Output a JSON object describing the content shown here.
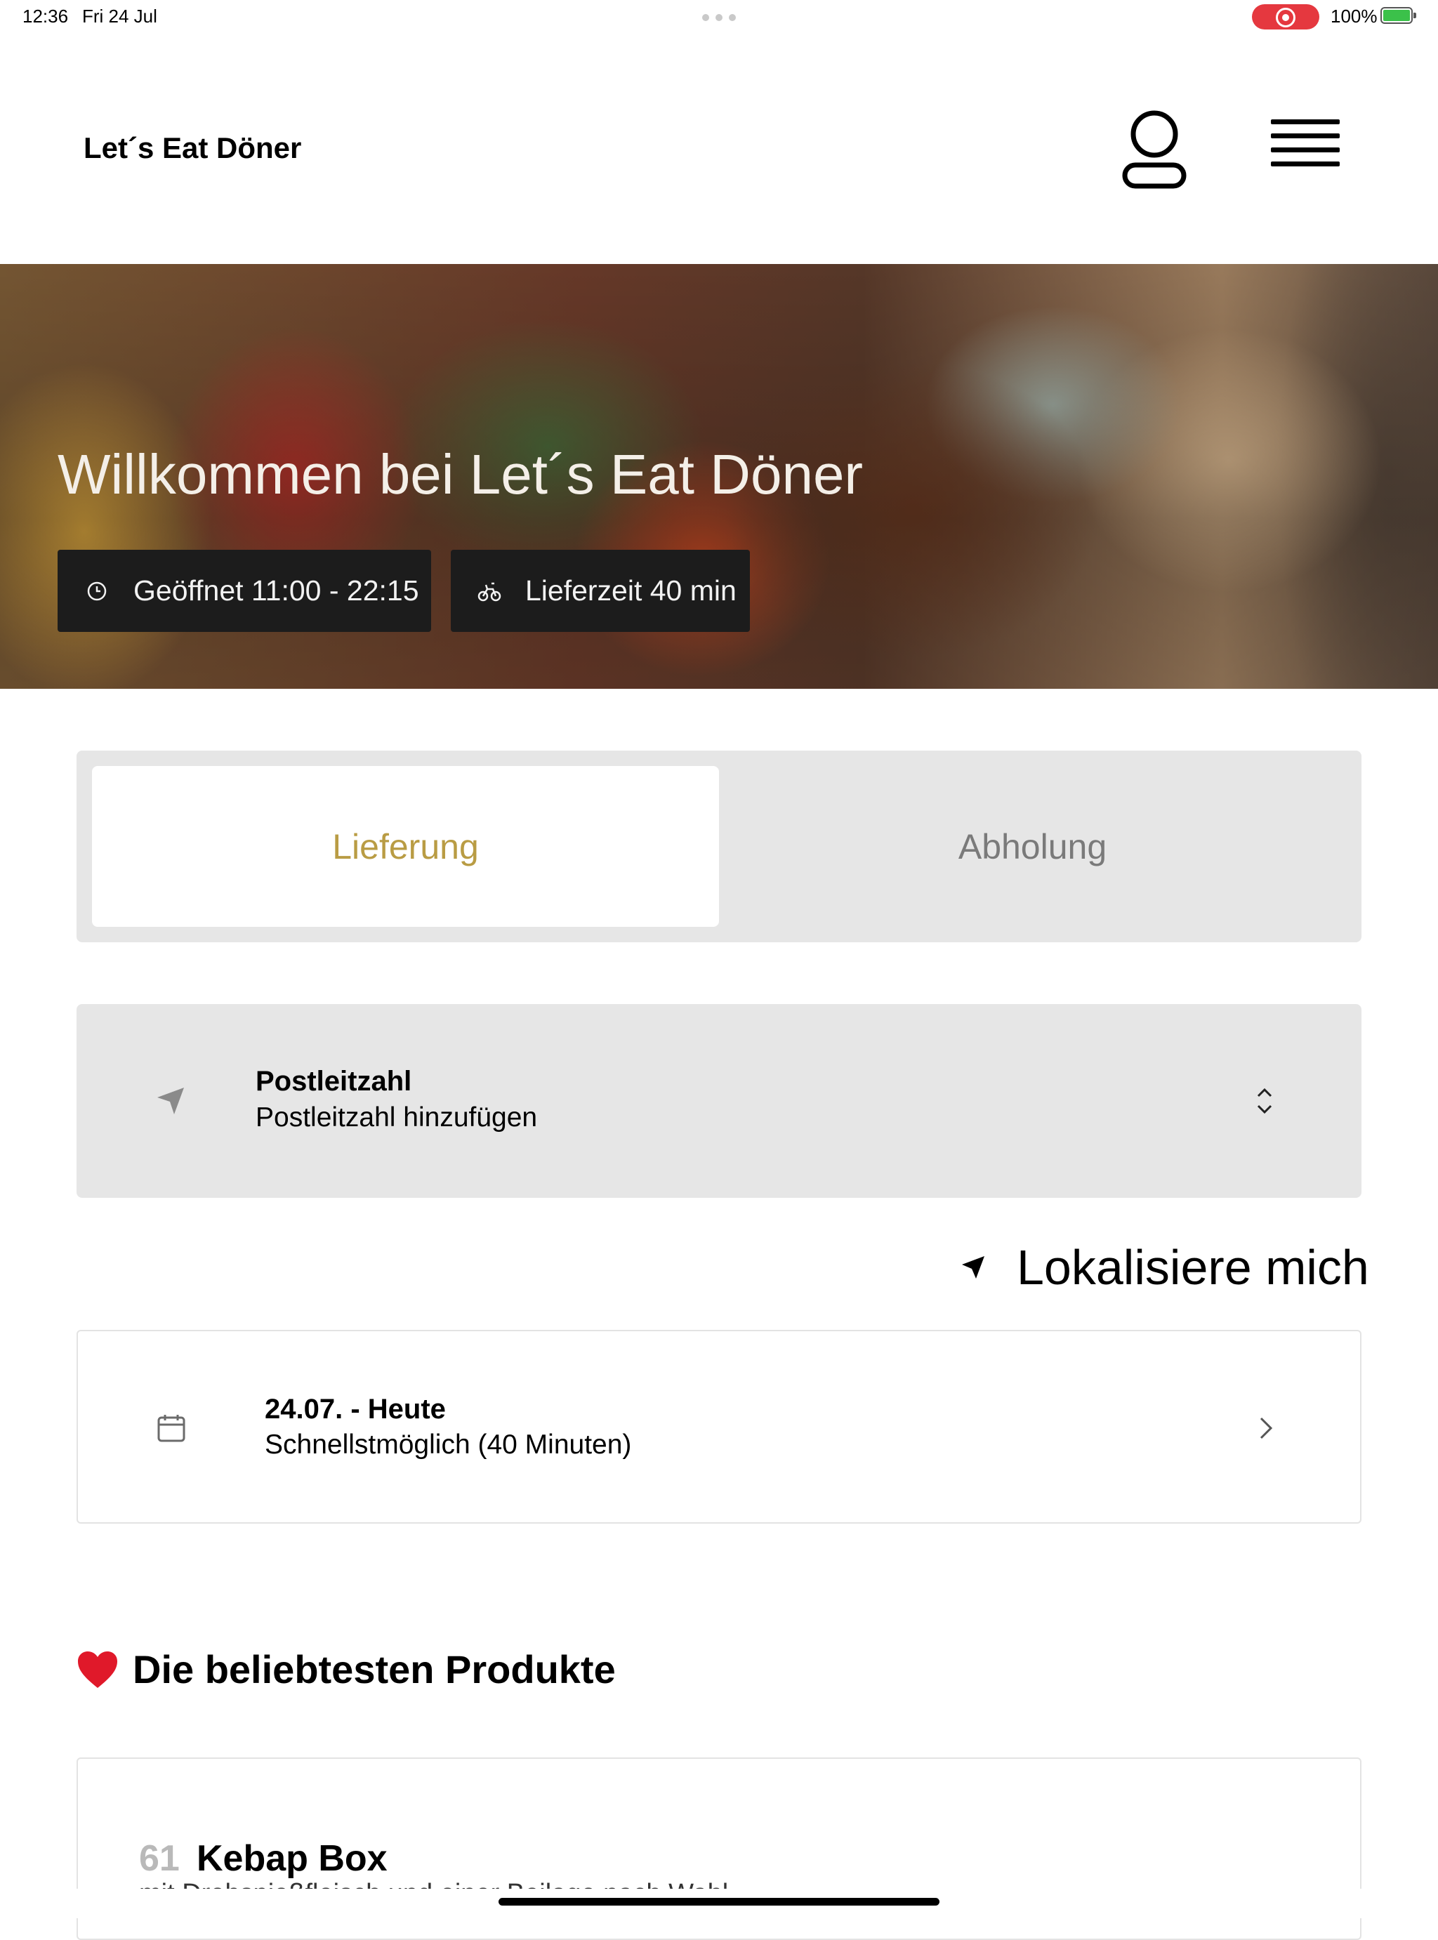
{
  "status_bar": {
    "time": "12:36",
    "date": "Fri 24 Jul",
    "battery": "100%",
    "recording_color": "#e5383f",
    "battery_color": "#3bc14a"
  },
  "header": {
    "brand": "Let´s Eat Döner",
    "icons": [
      "user-icon",
      "hamburger-menu-icon"
    ]
  },
  "hero": {
    "title": "Willkommen bei Let´s Eat Döner",
    "opening_hours": "Geöffnet 11:00 - 22:15",
    "delivery_time": "Lieferzeit 40 min",
    "icons": [
      "clock-icon",
      "bicycle-icon"
    ]
  },
  "order_mode": {
    "tabs": [
      {
        "label": "Lieferung",
        "active": true
      },
      {
        "label": "Abholung",
        "active": false
      }
    ],
    "accent_color": "#b99c44"
  },
  "postcode": {
    "label": "Postleitzahl",
    "value": "Postleitzahl hinzufügen"
  },
  "locate": {
    "label": "Lokalisiere mich"
  },
  "schedule": {
    "title": "24.07. - Heute",
    "subtitle": "Schnellstmöglich (40 Minuten)"
  },
  "popular": {
    "heading": "Die beliebtesten Produkte",
    "products": [
      {
        "number": "61",
        "name": "Kebap Box",
        "description": "mit Drehspießfleisch und einer Beilage nach Wahl"
      }
    ]
  }
}
